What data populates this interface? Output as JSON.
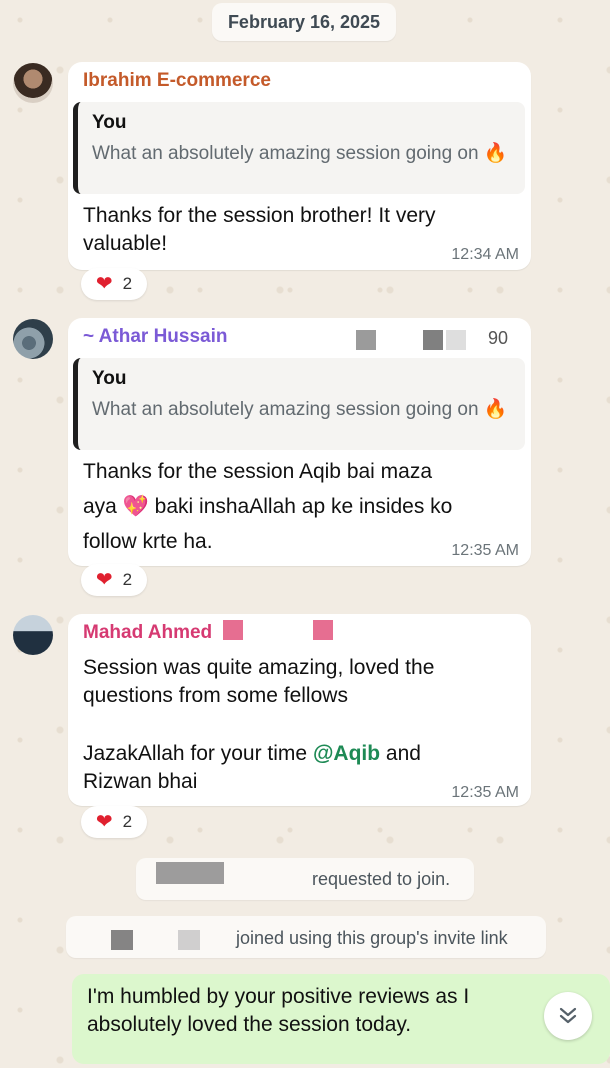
{
  "date_divider": "February 16, 2025",
  "messages": [
    {
      "sender": "Ibrahim E-commerce",
      "sender_color": "#c45a2a",
      "quote": {
        "author": "You",
        "text": "What an absolutely amazing session going on 🔥"
      },
      "lines": [
        "Thanks for the session brother! It very",
        "valuable!"
      ],
      "time": "12:34 AM",
      "reaction": {
        "emoji": "❤️",
        "count": "2"
      }
    },
    {
      "sender": "~ Athar Hussain",
      "sender_color": "#7b5ad6",
      "sender_suffix": "90",
      "quote": {
        "author": "You",
        "text": "What an absolutely amazing session going on 🔥"
      },
      "lines": [
        "Thanks for the session Aqib bai maza",
        "aya 💖 baki inshaAllah ap ke insides ko",
        "follow krte ha."
      ],
      "time": "12:35 AM",
      "reaction": {
        "emoji": "❤️",
        "count": "2"
      }
    },
    {
      "sender": "Mahad Ahmed",
      "sender_color": "#d63a72",
      "lines": [
        "Session was quite amazing, loved the",
        "questions from some fellows",
        "",
        "JazakAllah for your time ",
        "Rizwan bhai"
      ],
      "mention": "@Aqib",
      "mention_after": " and",
      "time": "12:35 AM",
      "reaction": {
        "emoji": "❤️",
        "count": "2"
      }
    }
  ],
  "system": {
    "requested": "requested to join.",
    "joined": "joined using this group's invite link"
  },
  "own_message": {
    "lines": [
      "I'm humbled by your positive reviews as I",
      "absolutely loved the session today."
    ]
  },
  "icons": {
    "scroll_down": "double-chevron-down-icon",
    "heart": "heart-icon"
  }
}
